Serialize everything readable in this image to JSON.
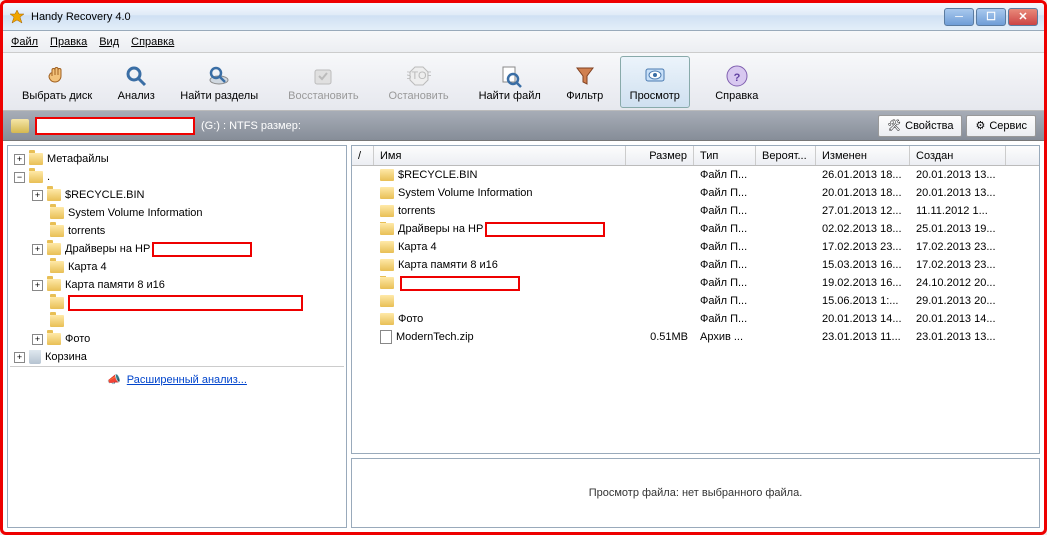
{
  "title": "Handy Recovery 4.0",
  "menu": {
    "file": "Файл",
    "edit": "Правка",
    "view": "Вид",
    "help": "Справка"
  },
  "toolbar": {
    "select_disk": "Выбрать диск",
    "analyze": "Анализ",
    "find_partitions": "Найти разделы",
    "recover": "Восстановить",
    "stop": "Остановить",
    "find_file": "Найти файл",
    "filter": "Фильтр",
    "preview": "Просмотр",
    "help": "Справка"
  },
  "subbar": {
    "suffix": "(G:) : NTFS размер:",
    "properties": "Свойства",
    "service": "Сервис"
  },
  "tree": {
    "metafiles": "Метафайлы",
    "dot": ".",
    "recycle": "$RECYCLE.BIN",
    "svi": "System Volume Information",
    "torrents": "torrents",
    "drivers": "Драйверы на HP",
    "card4": "Карта 4",
    "card816": "Карта памяти 8 и16",
    "photo": "Фото",
    "recyclebin": "Корзина",
    "advanced": "Расширенный анализ..."
  },
  "list": {
    "headers": {
      "slash": "/",
      "name": "Имя",
      "size": "Размер",
      "type": "Тип",
      "prob": "Вероят...",
      "modified": "Изменен",
      "created": "Создан"
    },
    "rows": [
      {
        "icon": "folder",
        "name": "$RECYCLE.BIN",
        "size": "",
        "type": "Файл П...",
        "prob": "",
        "modified": "26.01.2013 18...",
        "created": "20.01.2013 13..."
      },
      {
        "icon": "folder",
        "name": "System Volume Information",
        "size": "",
        "type": "Файл П...",
        "prob": "",
        "modified": "20.01.2013 18...",
        "created": "20.01.2013 13..."
      },
      {
        "icon": "folder",
        "name": "torrents",
        "size": "",
        "type": "Файл П...",
        "prob": "",
        "modified": "27.01.2013 12...",
        "created": "11.11.2012 1..."
      },
      {
        "icon": "folder",
        "name": "Драйверы на HP",
        "redacted": true,
        "size": "",
        "type": "Файл П...",
        "prob": "",
        "modified": "02.02.2013 18...",
        "created": "25.01.2013 19..."
      },
      {
        "icon": "folder",
        "name": "Карта 4",
        "size": "",
        "type": "Файл П...",
        "prob": "",
        "modified": "17.02.2013 23...",
        "created": "17.02.2013 23..."
      },
      {
        "icon": "folder",
        "name": "Карта памяти 8 и16",
        "size": "",
        "type": "Файл П...",
        "prob": "",
        "modified": "15.03.2013 16...",
        "created": "17.02.2013 23..."
      },
      {
        "icon": "folder",
        "name": "",
        "redacted": true,
        "size": "",
        "type": "Файл П...",
        "prob": "",
        "modified": "19.02.2013 16...",
        "created": "24.10.2012 20..."
      },
      {
        "icon": "folder",
        "name": "",
        "size": "",
        "type": "Файл П...",
        "prob": "",
        "modified": "15.06.2013 1:...",
        "created": "29.01.2013 20..."
      },
      {
        "icon": "folder",
        "name": "Фото",
        "size": "",
        "type": "Файл П...",
        "prob": "",
        "modified": "20.01.2013 14...",
        "created": "20.01.2013 14..."
      },
      {
        "icon": "file",
        "name": "ModernTech.zip",
        "size": "0.51MB",
        "type": "Архив ...",
        "prob": "",
        "modified": "23.01.2013 11...",
        "created": "23.01.2013 13..."
      }
    ]
  },
  "preview": {
    "text": "Просмотр файла: нет выбранного файла."
  }
}
